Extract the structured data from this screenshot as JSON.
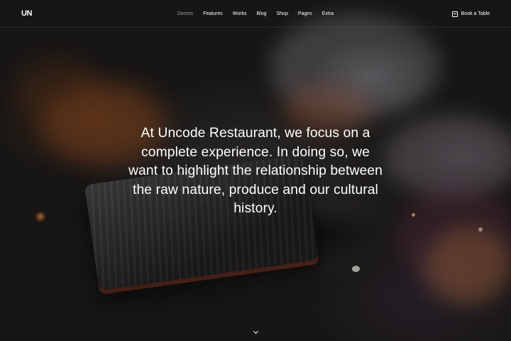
{
  "header": {
    "logo": "UN",
    "nav": [
      "Demos",
      "Features",
      "Works",
      "Blog",
      "Shop",
      "Pages",
      "Extra"
    ],
    "book_label": "Book a Table"
  },
  "hero": {
    "headline": "At Uncode Restaurant, we focus on a complete experience. In doing so, we want to highlight the relationship between the raw nature, produce and our cultural history."
  },
  "icons": {
    "book": "calendar-icon",
    "scroll": "chevron-down-icon"
  }
}
